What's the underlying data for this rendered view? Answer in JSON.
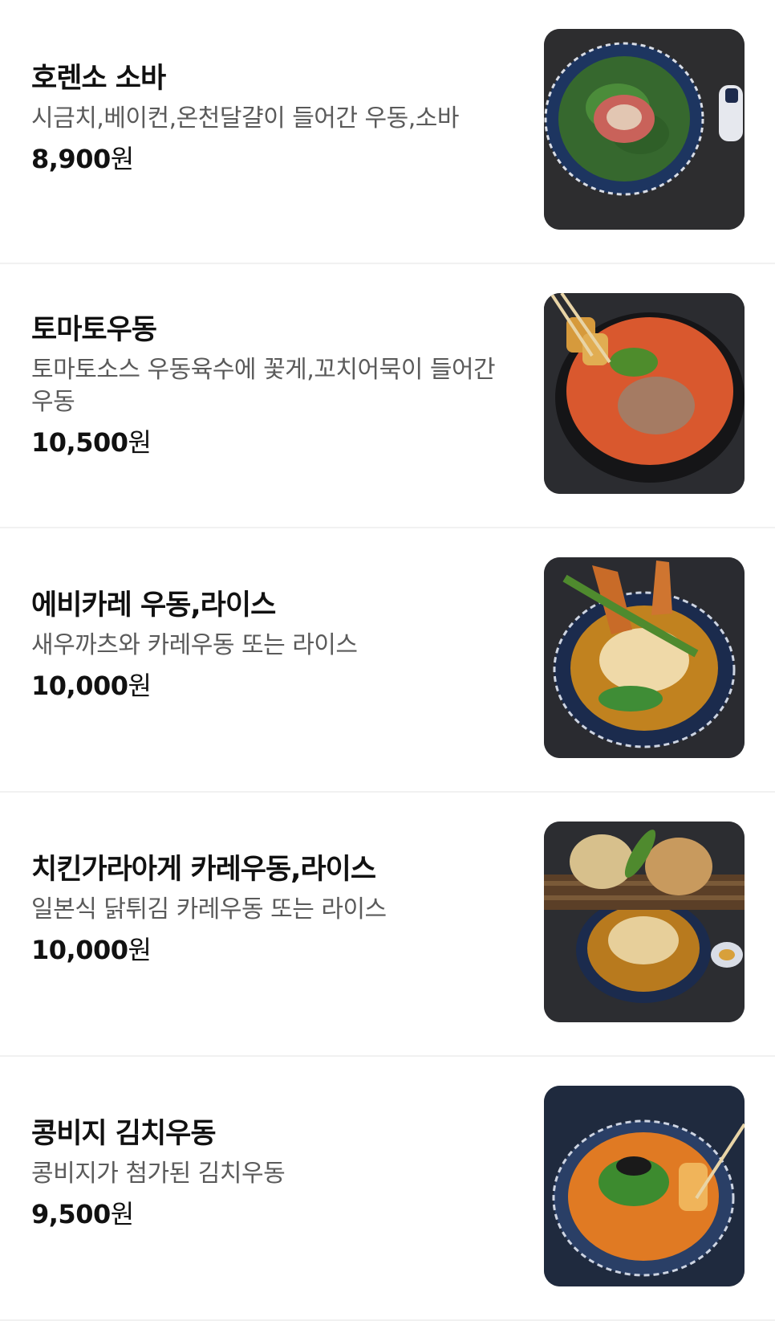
{
  "menu": {
    "items": [
      {
        "name": "호렌소 소바",
        "description": "시금치,베이컨,온천달걀이 들어간 우동,소바",
        "price": "8,900",
        "currency": "원",
        "photo_icon": "spinach-soba-bowl-photo"
      },
      {
        "name": "토마토우동",
        "description": "토마토소스 우동육수에 꽃게,꼬치어묵이 들어간 우동",
        "price": "10,500",
        "currency": "원",
        "photo_icon": "tomato-udon-pot-photo"
      },
      {
        "name": "에비카레 우동,라이스",
        "description": "새우까츠와 카레우동 또는 라이스",
        "price": "10,000",
        "currency": "원",
        "photo_icon": "shrimp-curry-udon-photo"
      },
      {
        "name": "치킨가라아게 카레우동,라이스",
        "description": "일본식 닭튀김 카레우동 또는 라이스",
        "price": "10,000",
        "currency": "원",
        "photo_icon": "chicken-karaage-curry-udon-photo"
      },
      {
        "name": "콩비지 김치우동",
        "description": "콩비지가 첨가된 김치우동",
        "price": "9,500",
        "currency": "원",
        "photo_icon": "kimchi-udon-bowl-photo"
      }
    ]
  }
}
